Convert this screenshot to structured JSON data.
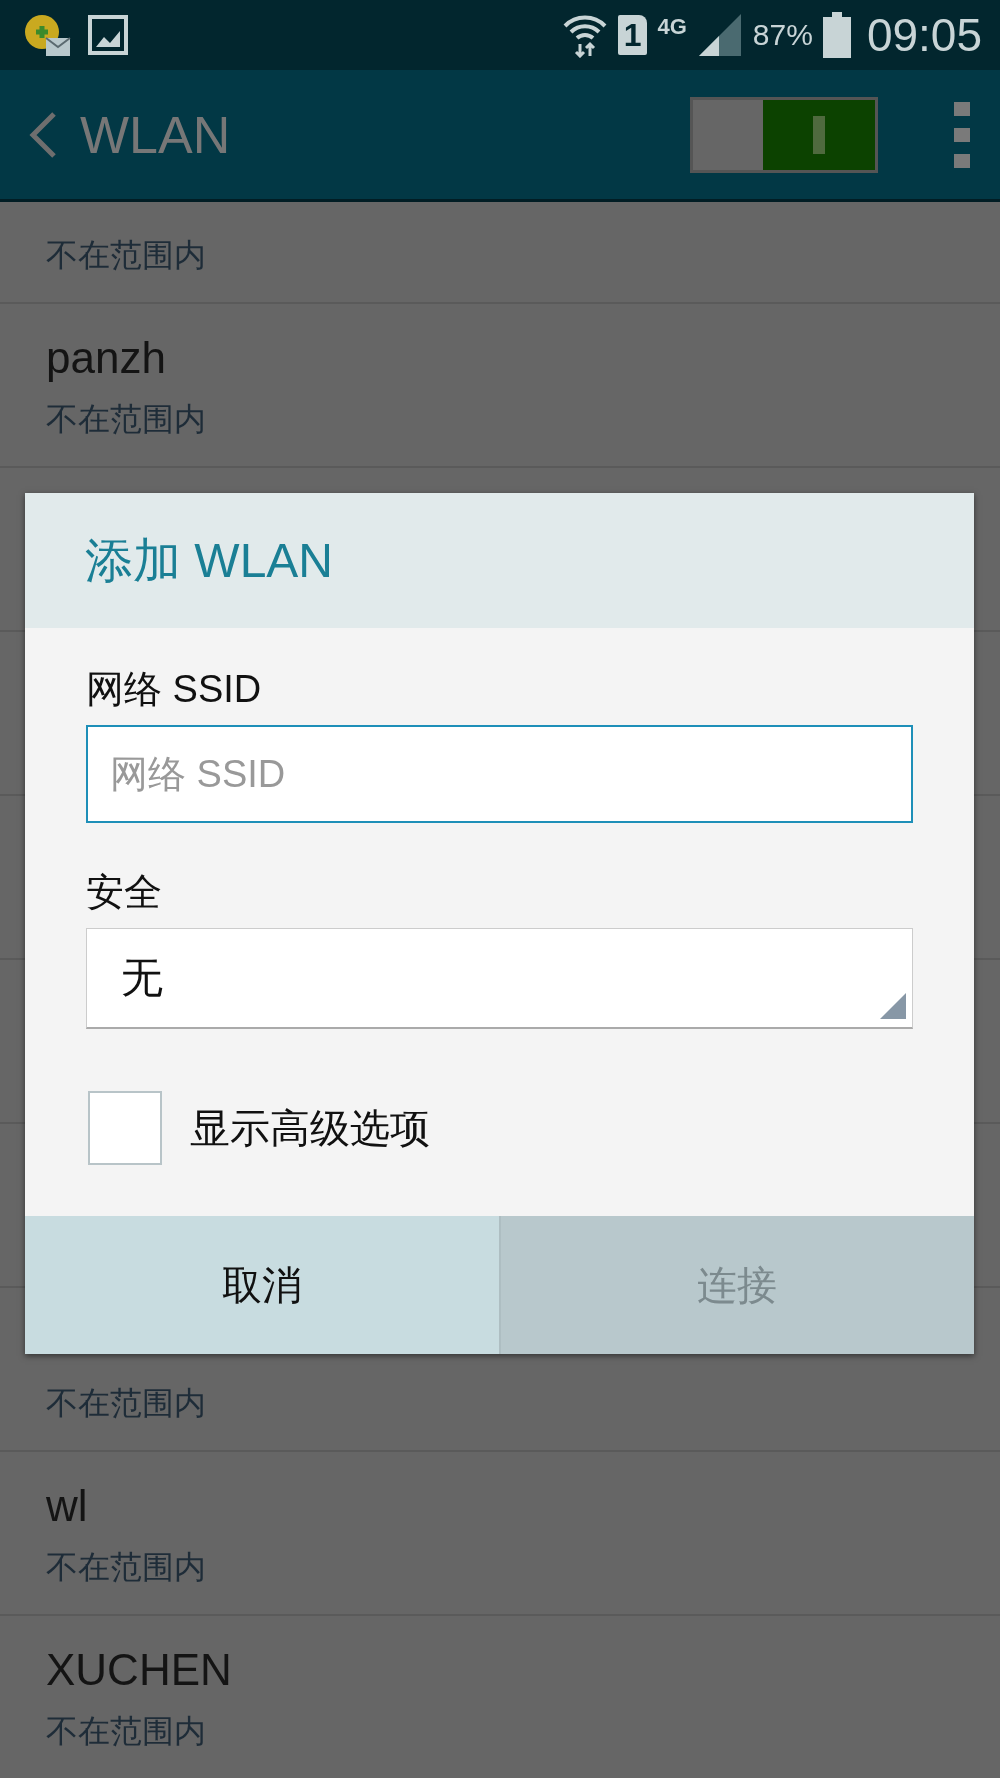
{
  "status_bar": {
    "sim_slot": "1",
    "network": "4G",
    "battery": "87%",
    "time": "09:05"
  },
  "header": {
    "title": "WLAN",
    "wlan_on": true
  },
  "networks_above": [
    {
      "status": "不在范围内"
    },
    {
      "name": "panzh",
      "status": "不在范围内"
    }
  ],
  "networks_below": [
    {
      "status": "不在范围内"
    },
    {
      "name": "wl",
      "status": "不在范围内"
    },
    {
      "name": "XUCHEN",
      "status": "不在范围内"
    }
  ],
  "dialog": {
    "title": "添加 WLAN",
    "fields": [
      {
        "kind": "text",
        "label": "网络 SSID",
        "placeholder": "网络 SSID"
      },
      {
        "kind": "select",
        "label": "安全",
        "value": "无"
      }
    ],
    "advanced": {
      "label": "显示高级选项",
      "checked": false
    },
    "buttons": [
      {
        "label": "取消",
        "disabled": false
      },
      {
        "label": "连接",
        "disabled": true
      }
    ]
  }
}
